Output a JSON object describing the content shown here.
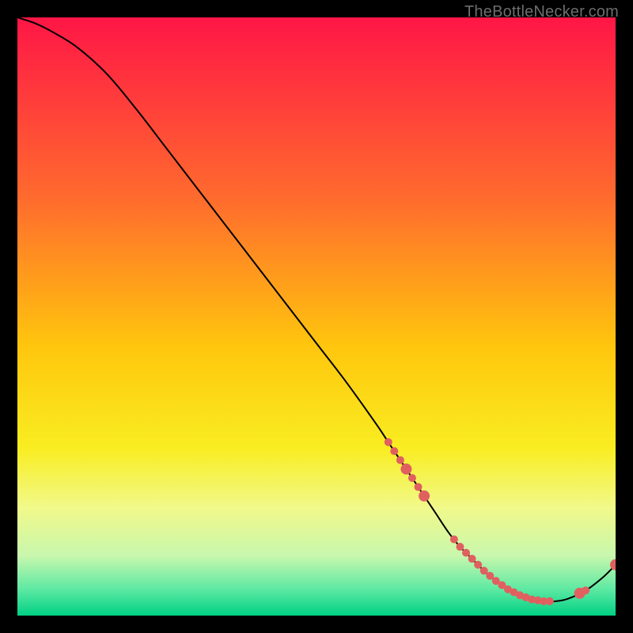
{
  "watermark": "TheBottleNecker.com",
  "chart_data": {
    "type": "line",
    "title": "",
    "xlabel": "",
    "ylabel": "",
    "xlim": [
      0,
      100
    ],
    "ylim": [
      0,
      100
    ],
    "background_gradient": {
      "stops": [
        {
          "offset": 0.0,
          "color": "#ff1646"
        },
        {
          "offset": 0.3,
          "color": "#ff6a2e"
        },
        {
          "offset": 0.55,
          "color": "#ffc60d"
        },
        {
          "offset": 0.72,
          "color": "#f9ed21"
        },
        {
          "offset": 0.82,
          "color": "#f1f98a"
        },
        {
          "offset": 0.9,
          "color": "#c8f7ad"
        },
        {
          "offset": 0.955,
          "color": "#5fe9a3"
        },
        {
          "offset": 1.0,
          "color": "#00d184"
        }
      ]
    },
    "series": [
      {
        "name": "bottleneck-curve",
        "color": "#000000",
        "x": [
          0,
          3,
          6,
          10,
          15,
          20,
          25,
          30,
          35,
          40,
          45,
          50,
          55,
          60,
          62,
          65,
          68,
          70,
          72,
          74,
          76,
          78,
          80,
          82,
          84,
          86,
          88,
          90,
          92,
          95,
          98,
          100
        ],
        "y": [
          100,
          99,
          97.5,
          95,
          90.5,
          84.5,
          78,
          71.5,
          65,
          58.5,
          52,
          45.5,
          39,
          32,
          29,
          24.5,
          20,
          17,
          14,
          11.5,
          9.5,
          7.5,
          5.8,
          4.4,
          3.4,
          2.7,
          2.4,
          2.4,
          2.8,
          4.2,
          6.5,
          8.5
        ]
      }
    ],
    "markers": {
      "name": "highlighted-range",
      "color": "#e06060",
      "radius_small": 5,
      "radius_large": 7,
      "points": [
        {
          "x": 62,
          "r": "small"
        },
        {
          "x": 63,
          "r": "small"
        },
        {
          "x": 64,
          "r": "small"
        },
        {
          "x": 65,
          "r": "large"
        },
        {
          "x": 66,
          "r": "small"
        },
        {
          "x": 67,
          "r": "small"
        },
        {
          "x": 68,
          "r": "large"
        },
        {
          "x": 73,
          "r": "small"
        },
        {
          "x": 74,
          "r": "small"
        },
        {
          "x": 75,
          "r": "small"
        },
        {
          "x": 76,
          "r": "small"
        },
        {
          "x": 77,
          "r": "small"
        },
        {
          "x": 78,
          "r": "small"
        },
        {
          "x": 79,
          "r": "small"
        },
        {
          "x": 80,
          "r": "small"
        },
        {
          "x": 81,
          "r": "small"
        },
        {
          "x": 82,
          "r": "small"
        },
        {
          "x": 83,
          "r": "small"
        },
        {
          "x": 84,
          "r": "small"
        },
        {
          "x": 85,
          "r": "small"
        },
        {
          "x": 86,
          "r": "small"
        },
        {
          "x": 87,
          "r": "small"
        },
        {
          "x": 88,
          "r": "small"
        },
        {
          "x": 89,
          "r": "small"
        },
        {
          "x": 94,
          "r": "large"
        },
        {
          "x": 95,
          "r": "small"
        },
        {
          "x": 100,
          "r": "large"
        }
      ]
    }
  }
}
